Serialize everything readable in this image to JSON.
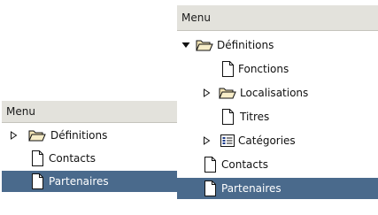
{
  "left_menu": {
    "title": "Menu",
    "items": [
      {
        "label": "Définitions"
      },
      {
        "label": "Contacts"
      },
      {
        "label": "Partenaires",
        "selected": true
      }
    ]
  },
  "right_menu": {
    "title": "Menu",
    "items": [
      {
        "label": "Définitions",
        "state": "expanded"
      },
      {
        "label": "Fonctions"
      },
      {
        "label": "Localisations",
        "state": "collapsed"
      },
      {
        "label": "Titres"
      },
      {
        "label": "Catégories",
        "state": "collapsed"
      },
      {
        "label": "Contacts"
      },
      {
        "label": "Partenaires",
        "selected": true
      }
    ]
  },
  "colors": {
    "header_bg": "#e3e2dc",
    "selection_bg": "#4a6a8c",
    "folder": "#f2e4b5"
  }
}
